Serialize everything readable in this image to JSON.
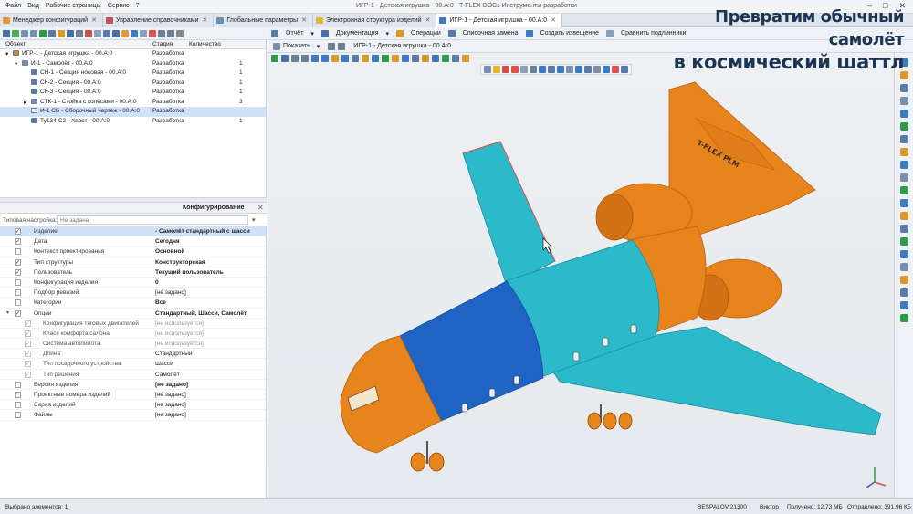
{
  "menu": [
    "Файл",
    "Вид",
    "Рабочие страницы",
    "Сервис",
    "?"
  ],
  "window_title": "ИГР-1 - Детская игрушка - 00.А:0 - T-FLEX DOCs Инструменты разработки",
  "tabs": [
    {
      "label": "Менеджер конфигураций",
      "active": false,
      "color": "#e39a2e"
    },
    {
      "label": "Управление справочниками",
      "active": false,
      "color": "#c85050"
    },
    {
      "label": "Глобальные параметры",
      "active": false,
      "color": "#6b8fb8"
    },
    {
      "label": "Электронная структура изделий",
      "active": false,
      "color": "#e3b82e"
    },
    {
      "label": "ИГР-1 - Детская игрушка - 00.А:0",
      "active": true,
      "color": "#3d7abf"
    }
  ],
  "right_toolbar": {
    "report": "Отчёт",
    "docs": "Документация",
    "ops": "Операции",
    "replace": "Списочная замена",
    "notice": "Создать извещение",
    "compare": "Сравнить подлинники",
    "show": "Показать",
    "breadcrumb": "ИГР-1 - Детская игрушка - 00.А:0"
  },
  "tree": {
    "headers": {
      "object": "Объект",
      "stage": "Стадия",
      "qty": "Количество"
    },
    "rows": [
      {
        "name": "ИГР-1 - Детская игрушка - 00.А:0",
        "stage": "Разработка",
        "qty": "",
        "level": 0,
        "icon": "#d77b2a",
        "expand": "▾"
      },
      {
        "name": "И-1 - Самолёт - 00.А:0",
        "stage": "Разработка",
        "qty": "1",
        "level": 1,
        "icon": "#7a8fb0",
        "expand": "▾"
      },
      {
        "name": "СН-1 - Секция носовая - 00.А:0",
        "stage": "Разработка",
        "qty": "1",
        "level": 2,
        "icon": "#5a7aa8",
        "expand": ""
      },
      {
        "name": "СК-2 - Секция - 00.А:0",
        "stage": "Разработка",
        "qty": "1",
        "level": 2,
        "icon": "#5a7aa8",
        "expand": ""
      },
      {
        "name": "СК-3 - Секция - 00.А:0",
        "stage": "Разработка",
        "qty": "1",
        "level": 2,
        "icon": "#5a7aa8",
        "expand": ""
      },
      {
        "name": "СТК-1 - Стойка с колёсами - 00.А:0",
        "stage": "Разработка",
        "qty": "3",
        "level": 2,
        "icon": "#7a8fb0",
        "expand": "▸"
      },
      {
        "name": "И-1 СБ - Сборочный чертеж - 00.А:0",
        "stage": "Разработка",
        "qty": "",
        "level": 2,
        "icon": "#e8e8e8",
        "expand": "",
        "selected": true
      },
      {
        "name": "Ту134-С2 - Хвост - 00.А:0",
        "stage": "Разработка",
        "qty": "1",
        "level": 2,
        "icon": "#5a7aa8",
        "expand": ""
      }
    ]
  },
  "config": {
    "title": "Конфигурирование",
    "typical_label": "Типовая настройка:",
    "typical_placeholder": "Не задана",
    "rows": [
      {
        "name": "Изделие",
        "value": "- Самолёт стандартный с шасси",
        "checked": true,
        "bold": true,
        "selected": true
      },
      {
        "name": "Дата",
        "value": "Сегодня",
        "checked": true,
        "bold": true
      },
      {
        "name": "Контекст проектирования",
        "value": "Основной",
        "checked": false,
        "bold": true
      },
      {
        "name": "Тип структуры",
        "value": "Конструкторская",
        "checked": true,
        "bold": true
      },
      {
        "name": "Пользователь",
        "value": "Текущий пользователь",
        "checked": true,
        "bold": true
      },
      {
        "name": "Конфигурация изделия",
        "value": "0",
        "checked": false,
        "bold": true
      },
      {
        "name": "Подбор ревизий",
        "value": "[не задано]",
        "checked": false
      },
      {
        "name": "Категории",
        "value": "Все",
        "checked": false,
        "bold": true
      },
      {
        "name": "Опции",
        "value": "Стандартный, Шасси, Самолёт",
        "checked": true,
        "bold": true,
        "expand": "▾"
      },
      {
        "name": "Конфигурация тяговых двигателей",
        "value": "[не используется]",
        "checked": true,
        "sub": true,
        "grey": true
      },
      {
        "name": "Класс комфорта салона",
        "value": "[не используется]",
        "checked": true,
        "sub": true,
        "grey": true
      },
      {
        "name": "Система автопилота",
        "value": "[не используется]",
        "checked": true,
        "sub": true,
        "grey": true
      },
      {
        "name": "Длина",
        "value": "Стандартный",
        "checked": true,
        "sub": true
      },
      {
        "name": "Тип посадочного устройства",
        "value": "Шасси",
        "checked": true,
        "sub": true
      },
      {
        "name": "Тип решения",
        "value": "Самолёт",
        "checked": true,
        "sub": true
      },
      {
        "name": "Версия изделия",
        "value": "[не задано]",
        "checked": false,
        "bold": true
      },
      {
        "name": "Проектные номера изделий",
        "value": "[не задано]",
        "checked": false
      },
      {
        "name": "Серия изделий",
        "value": "[не задано]",
        "checked": false
      },
      {
        "name": "Файлы",
        "value": "[не задано]",
        "checked": false
      }
    ]
  },
  "status": {
    "selected": "Выбрано элементов: 1",
    "server": "BESPALOV:21300",
    "user": "Виктор",
    "received": "Получено: 12,73 МБ",
    "sent": "Отправлено: 391,96 КБ"
  },
  "overlay": {
    "line1": "Превратим обычный самолёт",
    "line2": "в космический шаттл"
  },
  "model": {
    "tail_text": "T-FLEX PLM",
    "colors": {
      "orange": "#e8841c",
      "cyan": "#2cb9c9",
      "blue": "#1f64c4",
      "accent": "#d9534f"
    }
  }
}
